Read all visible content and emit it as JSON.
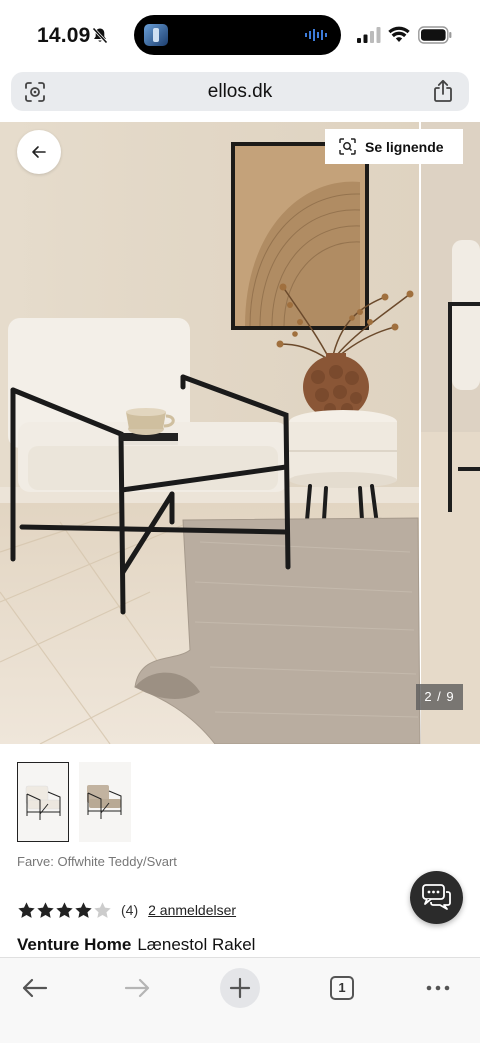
{
  "status_bar": {
    "time": "14.09",
    "icons": [
      "bell-muted-icon",
      "signal-icon",
      "wifi-icon",
      "battery-icon"
    ]
  },
  "browser": {
    "url": "ellos.dk",
    "icons": [
      "page-tools-icon",
      "share-icon"
    ]
  },
  "gallery": {
    "similar_label": "Se lignende",
    "counter": "2 / 9",
    "back_icon": "arrow-left-icon",
    "similar_icon": "visual-search-icon"
  },
  "product": {
    "color_label": "Farve: Offwhite Teddy/Svart",
    "rating_value": 4,
    "rating_max": 5,
    "rating_count": "(4)",
    "reviews_link": "2 anmeldelser",
    "brand": "Venture Home",
    "name": "Lænestol Rakel"
  },
  "chat": {
    "icon": "chat-icon"
  },
  "toolbar": {
    "tab_count": "1",
    "icons": [
      "back-arrow-icon",
      "forward-arrow-icon",
      "plus-icon",
      "tabs-icon",
      "more-icon"
    ]
  },
  "colors": {
    "star_filled": "#222222",
    "star_empty": "#cccccc",
    "chat_bg": "#2b2b2b",
    "url_bar_bg": "#e9ebee"
  }
}
